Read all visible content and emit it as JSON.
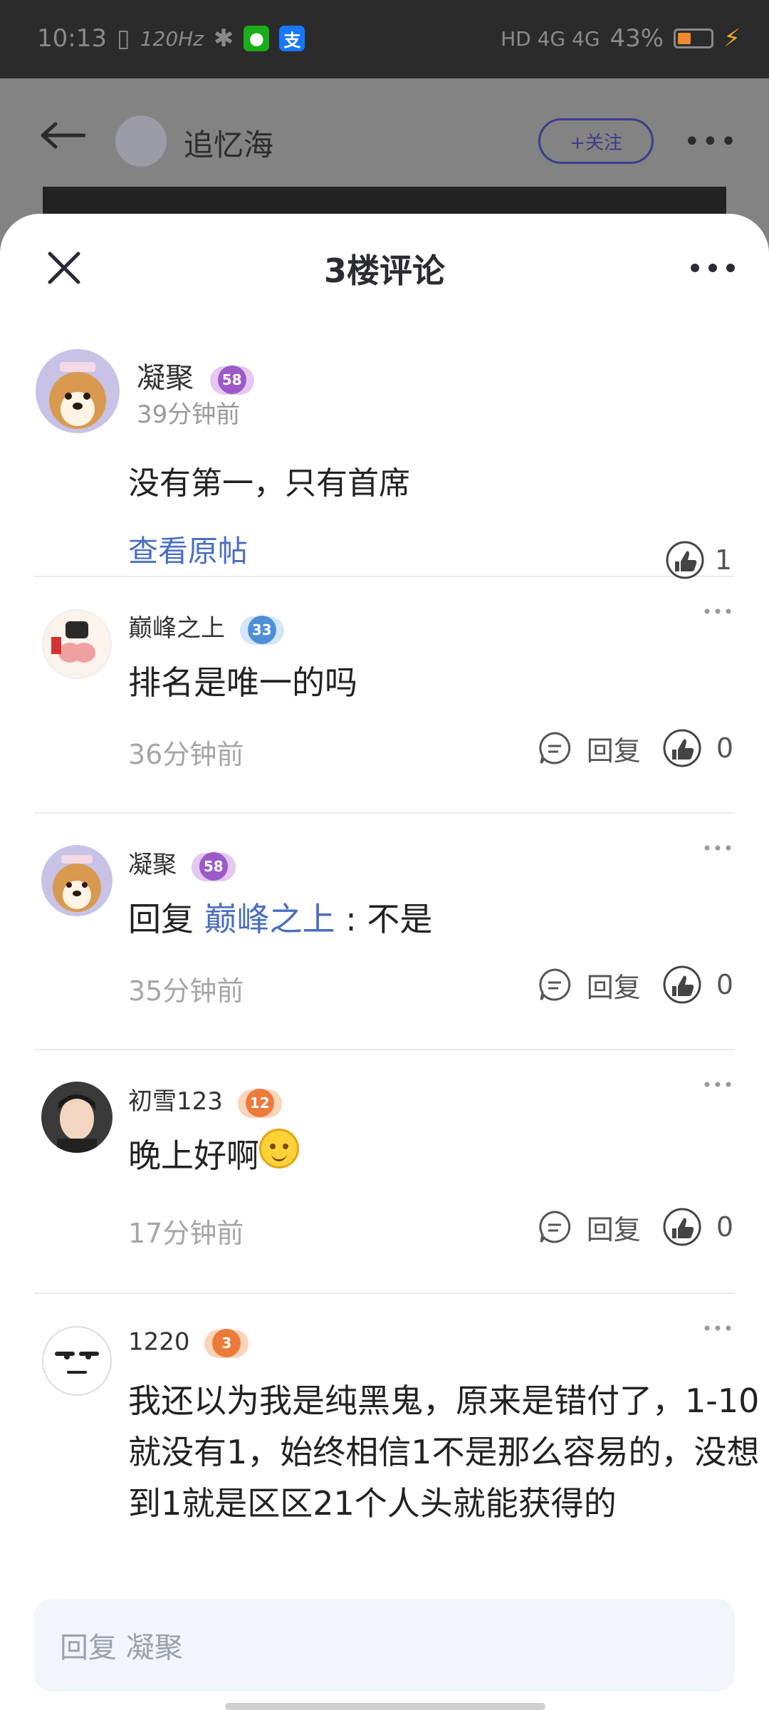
{
  "status_bar": {
    "time": "10:13",
    "refresh_rate": "120Hz",
    "network": "HD 4G 4G",
    "battery": "43%"
  },
  "background_page": {
    "author_name": "追忆海",
    "follow_label": "+关注"
  },
  "sheet": {
    "title": "3楼评论"
  },
  "main_comment": {
    "author": "凝聚",
    "level": "58",
    "time": "39分钟前",
    "text": "没有第一，只有首席",
    "view_original": "查看原帖",
    "likes": "1"
  },
  "replies": [
    {
      "author": "巅峰之上",
      "level": "33",
      "text": "排名是唯一的吗",
      "time": "36分钟前",
      "reply_label": "回复",
      "likes": "0"
    },
    {
      "author": "凝聚",
      "level": "58",
      "reply_prefix": "回复",
      "mention": "巅峰之上",
      "text": " : 不是",
      "time": "35分钟前",
      "reply_label": "回复",
      "likes": "0"
    },
    {
      "author": "初雪123",
      "level": "12",
      "text": "晚上好啊",
      "time": "17分钟前",
      "reply_label": "回复",
      "likes": "0"
    },
    {
      "author": "1220",
      "level": "3",
      "text": "我还以为我是纯黑鬼，原来是错付了，1-10就没有1，始终相信1不是那么容易的，没想到1就是区区21个人头就能获得的"
    }
  ],
  "reply_input": {
    "placeholder": "回复 凝聚"
  },
  "colors": {
    "accent_link": "#4a6ec0",
    "level_purple": "#9b5ac8",
    "level_blue": "#4e8fd8",
    "level_orange": "#ec7a3a"
  }
}
